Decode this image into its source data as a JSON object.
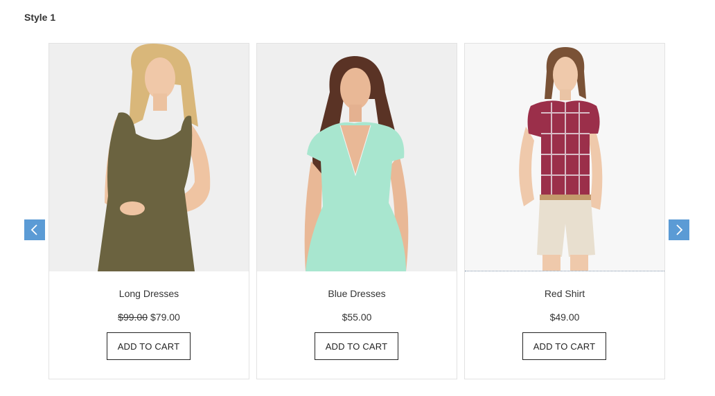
{
  "section": {
    "title": "Style 1"
  },
  "carousel": {
    "prev_icon": "chevron-left-icon",
    "next_icon": "chevron-right-icon",
    "nav_color": "#5b9bd5"
  },
  "products": [
    {
      "name": "Long Dresses",
      "old_price": "$99.00",
      "price": "$79.00",
      "cart_label": "ADD TO CART",
      "image": "model-olive-dress-image"
    },
    {
      "name": "Blue Dresses",
      "old_price": "",
      "price": "$55.00",
      "cart_label": "ADD TO CART",
      "image": "model-mint-dress-image"
    },
    {
      "name": "Red Shirt",
      "old_price": "",
      "price": "$49.00",
      "cart_label": "ADD TO CART",
      "image": "model-plaid-shirt-image"
    }
  ]
}
